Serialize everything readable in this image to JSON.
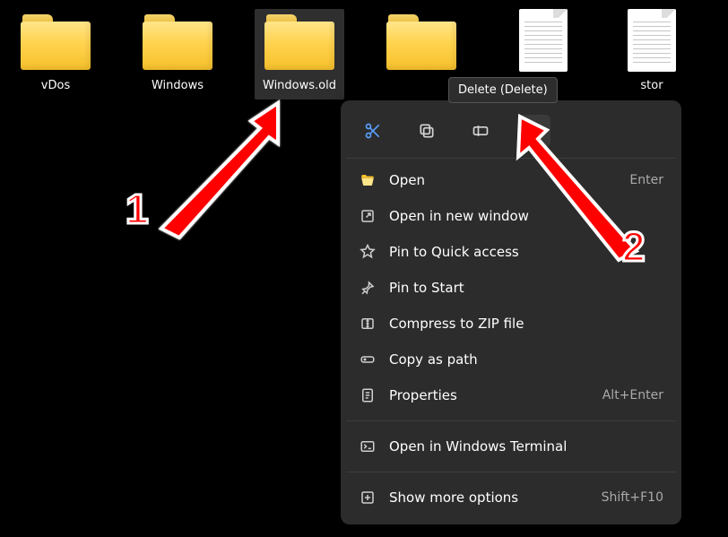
{
  "tooltip": "Delete (Delete)",
  "items": [
    {
      "type": "folder",
      "label": "vDos",
      "selected": false
    },
    {
      "type": "folder",
      "label": "Windows",
      "selected": false
    },
    {
      "type": "folder",
      "label": "Windows.old",
      "selected": true
    },
    {
      "type": "folder",
      "label": "",
      "selected": false
    },
    {
      "type": "doc",
      "label": "",
      "selected": false
    },
    {
      "type": "doc",
      "label": "stor",
      "selected": false
    }
  ],
  "action_icons": {
    "cut": "cut",
    "copy": "copy",
    "rename": "rename",
    "delete": "delete"
  },
  "menu": {
    "open": {
      "label": "Open",
      "accel": "Enter"
    },
    "open_new_window": {
      "label": "Open in new window",
      "accel": ""
    },
    "pin_quick": {
      "label": "Pin to Quick access",
      "accel": ""
    },
    "pin_start": {
      "label": "Pin to Start",
      "accel": ""
    },
    "compress_zip": {
      "label": "Compress to ZIP file",
      "accel": ""
    },
    "copy_path": {
      "label": "Copy as path",
      "accel": ""
    },
    "properties": {
      "label": "Properties",
      "accel": "Alt+Enter"
    },
    "open_terminal": {
      "label": "Open in Windows Terminal",
      "accel": ""
    },
    "show_more": {
      "label": "Show more options",
      "accel": "Shift+F10"
    }
  },
  "annotations": {
    "num1": "1",
    "num2": "2"
  }
}
